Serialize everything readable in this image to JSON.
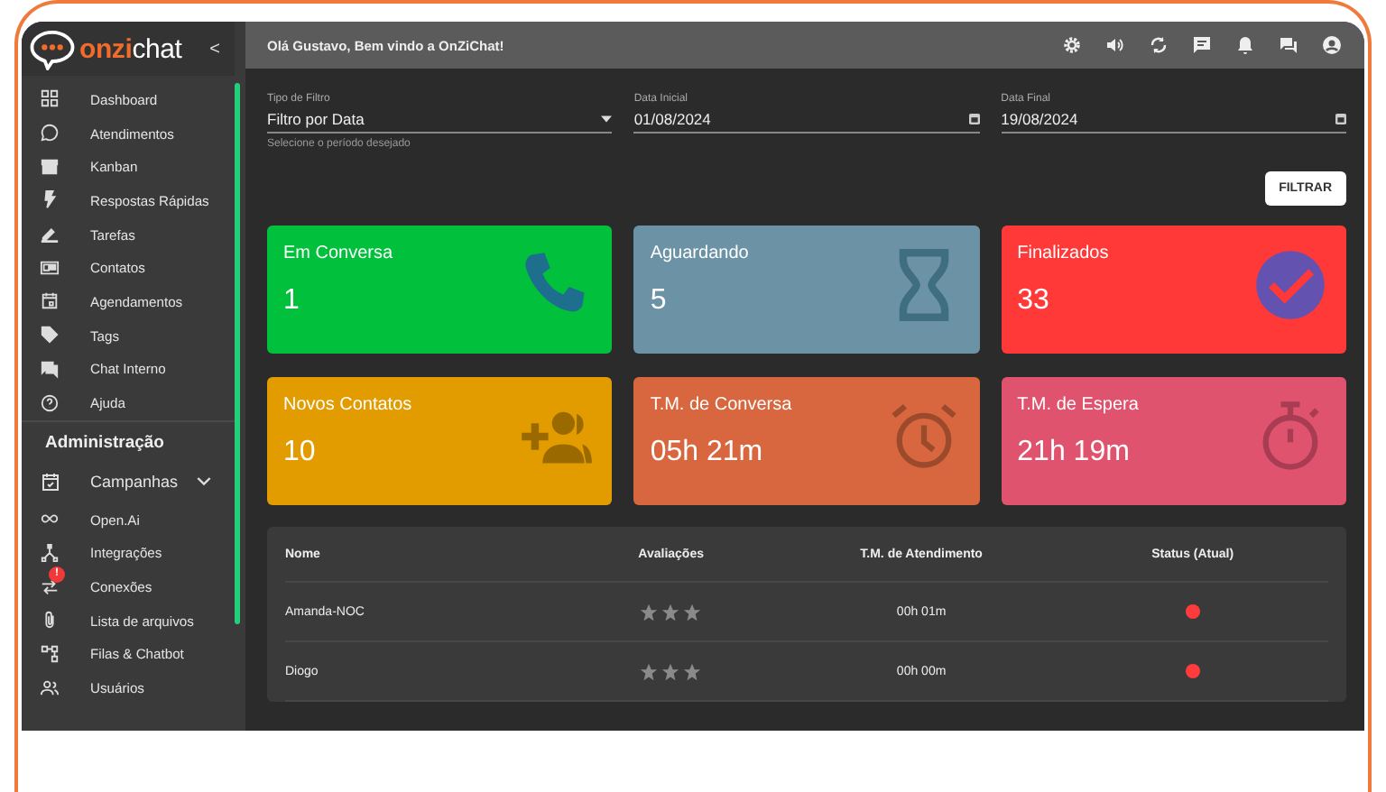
{
  "sidebar": {
    "logo": {
      "brand_bold": "onzi",
      "brand_light": "chat"
    },
    "collapse": "<",
    "items": [
      {
        "kind": "item",
        "label": "Dashboard"
      },
      {
        "kind": "item",
        "label": "Atendimentos"
      },
      {
        "kind": "item",
        "label": "Kanban"
      },
      {
        "kind": "item",
        "label": "Respostas Rápidas"
      },
      {
        "kind": "item",
        "label": "Tarefas"
      },
      {
        "kind": "item",
        "label": "Contatos"
      },
      {
        "kind": "item",
        "label": "Agendamentos"
      },
      {
        "kind": "item",
        "label": "Tags"
      },
      {
        "kind": "item",
        "label": "Chat Interno"
      },
      {
        "kind": "item",
        "label": "Ajuda"
      },
      {
        "kind": "section",
        "label": "Administração"
      },
      {
        "kind": "group",
        "label": "Campanhas",
        "expanded": false
      },
      {
        "kind": "item",
        "label": "Open.Ai"
      },
      {
        "kind": "item",
        "label": "Integrações"
      },
      {
        "kind": "item",
        "label": "Conexões",
        "badge": "!"
      },
      {
        "kind": "item",
        "label": "Lista de arquivos"
      },
      {
        "kind": "item",
        "label": "Filas & Chatbot"
      },
      {
        "kind": "item",
        "label": "Usuários"
      }
    ]
  },
  "header": {
    "greeting": "Olá Gustavo, Bem vindo a OnZiChat!"
  },
  "filters": {
    "type": {
      "label": "Tipo de Filtro",
      "value": "Filtro por Data",
      "helper": "Selecione o período desejado"
    },
    "start": {
      "label": "Data Inicial",
      "value": "01/08/2024"
    },
    "end": {
      "label": "Data Final",
      "value": "19/08/2024"
    },
    "button": "FILTRAR"
  },
  "cards": [
    {
      "title": "Em Conversa",
      "value": "1",
      "color": "#00c03c"
    },
    {
      "title": "Aguardando",
      "value": "5",
      "color": "#6b93a5"
    },
    {
      "title": "Finalizados",
      "value": "33",
      "color": "#ff3838"
    },
    {
      "title": "Novos Contatos",
      "value": "10",
      "color": "#e29c00"
    },
    {
      "title": "T.M. de Conversa",
      "value": "05h 21m",
      "color": "#d8673f"
    },
    {
      "title": "T.M. de Espera",
      "value": "21h 19m",
      "color": "#e0536f"
    }
  ],
  "table": {
    "columns": [
      "Nome",
      "Avaliações",
      "T.M. de Atendimento",
      "Status (Atual)"
    ],
    "rows": [
      {
        "name": "Amanda-NOC",
        "stars": 0,
        "time": "00h 01m",
        "color": "#ff3b3b"
      },
      {
        "name": "Diogo",
        "stars": 0,
        "time": "00h 00m",
        "color": "#ff3b3b"
      }
    ]
  }
}
